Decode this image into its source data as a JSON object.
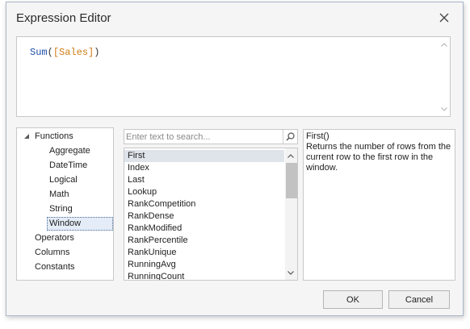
{
  "dialog": {
    "title": "Expression Editor",
    "close_icon": "close-icon"
  },
  "expression": {
    "function": "Sum",
    "open_paren": "(",
    "field": "[Sales]",
    "close_paren": ")"
  },
  "tree": {
    "items": [
      {
        "label": "Functions",
        "expanded": true
      },
      {
        "label": "Aggregate"
      },
      {
        "label": "DateTime"
      },
      {
        "label": "Logical"
      },
      {
        "label": "Math"
      },
      {
        "label": "String"
      },
      {
        "label": "Window",
        "selected": true
      },
      {
        "label": "Operators"
      },
      {
        "label": "Columns"
      },
      {
        "label": "Constants"
      }
    ]
  },
  "search": {
    "placeholder": "Enter text to search...",
    "value": ""
  },
  "functions_list": {
    "items": [
      "First",
      "Index",
      "Last",
      "Lookup",
      "RankCompetition",
      "RankDense",
      "RankModified",
      "RankPercentile",
      "RankUnique",
      "RunningAvg",
      "RunningCount"
    ],
    "selected": "First"
  },
  "description": {
    "name": "First()",
    "text": "Returns the number of rows from the current row to the first row in the window."
  },
  "buttons": {
    "ok": "OK",
    "cancel": "Cancel"
  },
  "colors": {
    "function": "#1f4fa8",
    "field": "#d07b12",
    "selection": "#dfe3ea"
  }
}
